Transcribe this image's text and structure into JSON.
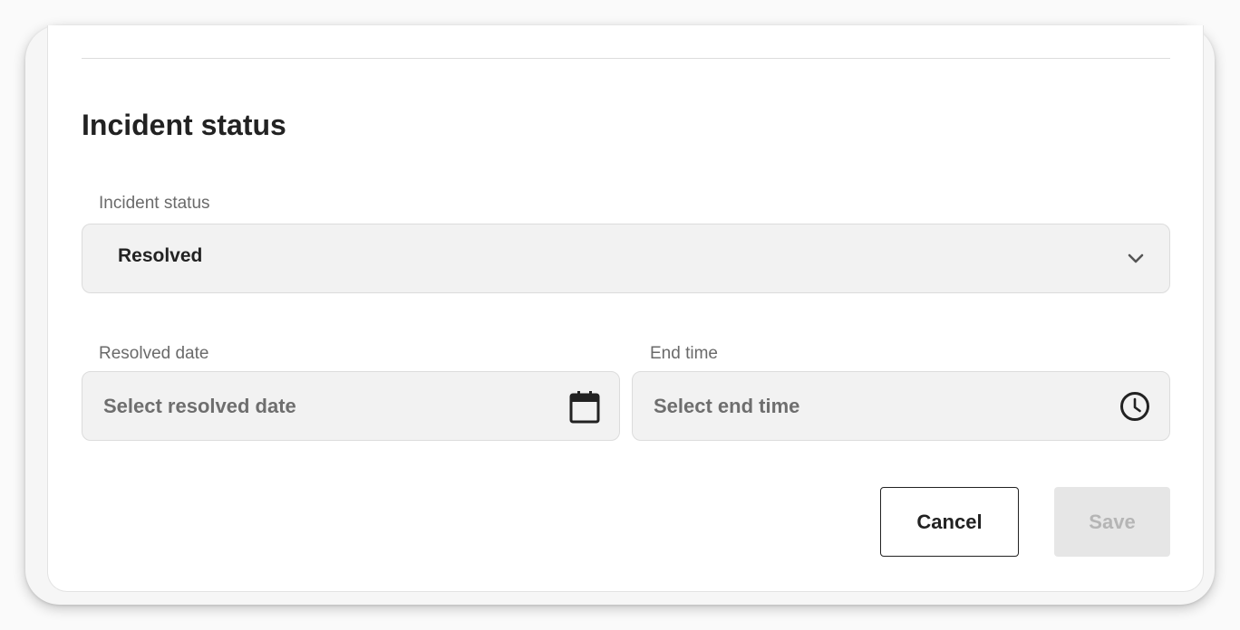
{
  "section": {
    "title": "Incident status"
  },
  "status_field": {
    "label": "Incident status",
    "value": "Resolved",
    "icon": "chevron-down-icon"
  },
  "resolved_date_field": {
    "label": "Resolved date",
    "placeholder": "Select resolved date",
    "icon": "calendar-icon"
  },
  "end_time_field": {
    "label": "End time",
    "placeholder": "Select end time",
    "icon": "clock-icon"
  },
  "actions": {
    "cancel_label": "Cancel",
    "save_label": "Save",
    "save_enabled": false
  },
  "colors": {
    "text_primary": "#222222",
    "text_muted": "#6e6e6e",
    "field_bg": "#f2f2f2",
    "disabled_bg": "#e6e6e6",
    "disabled_text": "#b5b5b5"
  }
}
